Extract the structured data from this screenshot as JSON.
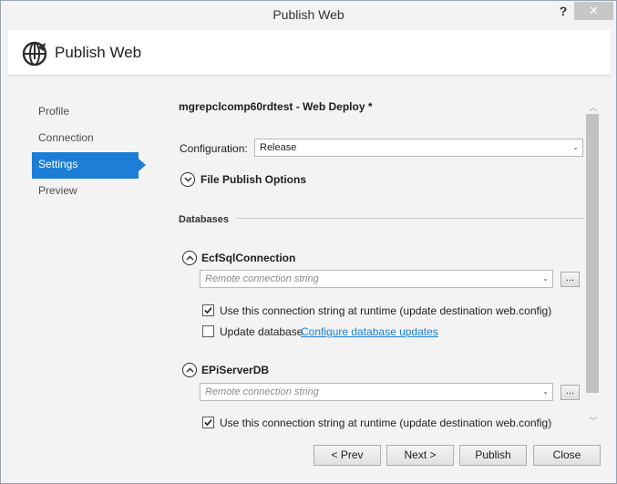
{
  "window": {
    "title": "Publish Web",
    "help_label": "?",
    "close_label": "✕"
  },
  "header": {
    "title": "Publish Web"
  },
  "nav": {
    "items": [
      {
        "label": "Profile"
      },
      {
        "label": "Connection"
      },
      {
        "label": "Settings",
        "active": true
      },
      {
        "label": "Preview"
      }
    ]
  },
  "content": {
    "profile_title": "mgrepclcomp60rdtest - Web Deploy *",
    "configuration_label": "Configuration:",
    "configuration_value": "Release",
    "file_publish_options_label": "File Publish Options",
    "databases_title": "Databases",
    "connections": [
      {
        "name": "EcfSqlConnection",
        "connection_placeholder": "Remote connection string",
        "browse_label": "...",
        "use_at_runtime_label": "Use this connection string at runtime (update destination web.config)",
        "use_at_runtime_checked": true,
        "update_database_label": "Update database",
        "update_database_checked": false,
        "configure_link": "Configure database updates"
      },
      {
        "name": "EPiServerDB",
        "connection_placeholder": "Remote connection string",
        "browse_label": "...",
        "use_at_runtime_label": "Use this connection string at runtime (update destination web.config)",
        "use_at_runtime_checked": true
      }
    ]
  },
  "buttons": {
    "prev": "< Prev",
    "next": "Next >",
    "publish": "Publish",
    "close": "Close"
  },
  "colors": {
    "accent": "#1c7ed6",
    "link": "#1c7ed6",
    "scrollbar": "#c2c2c2"
  }
}
